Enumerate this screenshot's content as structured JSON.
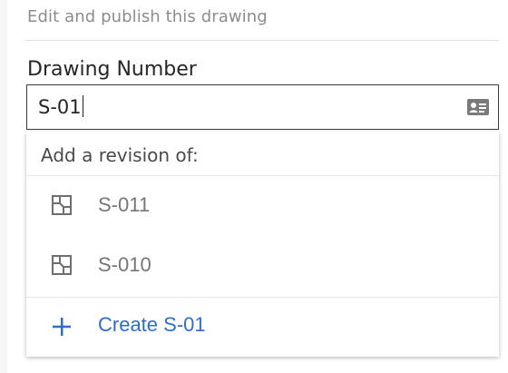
{
  "header": {
    "subtitle": "Edit and publish this drawing"
  },
  "field": {
    "label": "Drawing Number",
    "value": "S-01",
    "icon": "contact-card-icon"
  },
  "dropdown": {
    "header": "Add a revision of:",
    "items": [
      {
        "label": "S-011",
        "icon": "drawing-icon"
      },
      {
        "label": "S-010",
        "icon": "drawing-icon"
      }
    ],
    "create": {
      "label": "Create S-01",
      "icon": "plus-icon"
    }
  },
  "colors": {
    "accent": "#2e6ec7",
    "muted_text": "#767676",
    "border": "#3a3a3a"
  }
}
